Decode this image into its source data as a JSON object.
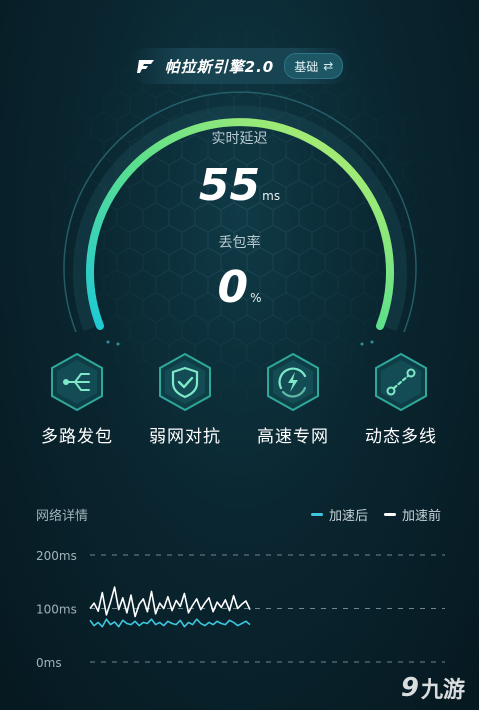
{
  "engine": {
    "title": "帕拉斯引擎2.0",
    "mode_label": "基础",
    "swap_icon": "⇄"
  },
  "latency": {
    "label": "实时延迟",
    "value": "55",
    "unit": "ms"
  },
  "packet_loss": {
    "label": "丢包率",
    "value": "0",
    "unit": "%"
  },
  "features": [
    {
      "label": "多路发包",
      "icon": "multipath-icon"
    },
    {
      "label": "弱网对抗",
      "icon": "shield-check-icon"
    },
    {
      "label": "高速专网",
      "icon": "lightning-icon"
    },
    {
      "label": "动态多线",
      "icon": "route-icon"
    }
  ],
  "details": {
    "title": "网络详情"
  },
  "legend": [
    {
      "label": "加速后",
      "color": "#3ec7e0"
    },
    {
      "label": "加速前",
      "color": "#ffffff"
    }
  ],
  "chart_data": {
    "type": "line",
    "ylabels": [
      "200ms",
      "100ms",
      "0ms"
    ],
    "ylim": [
      0,
      200
    ],
    "x": [
      0,
      1,
      2,
      3,
      4,
      5,
      6,
      7,
      8,
      9,
      10,
      11,
      12,
      13,
      14,
      15,
      16,
      17,
      18,
      19,
      20,
      21,
      22,
      23,
      24,
      25,
      26,
      27,
      28,
      29,
      30,
      31,
      32,
      33,
      34,
      35,
      36,
      37,
      38,
      39
    ],
    "series": [
      {
        "name": "加速后",
        "color": "#3ec7e0",
        "values": [
          78,
          68,
          74,
          66,
          80,
          70,
          75,
          66,
          78,
          72,
          70,
          76,
          68,
          74,
          72,
          80,
          70,
          74,
          68,
          76,
          72,
          70,
          78,
          66,
          74,
          70,
          80,
          72,
          68,
          74,
          70,
          76,
          72,
          70,
          78,
          74,
          68,
          72,
          76,
          70
        ]
      },
      {
        "name": "加速前",
        "color": "#ffffff",
        "values": [
          100,
          110,
          95,
          130,
          88,
          112,
          140,
          98,
          120,
          92,
          125,
          85,
          108,
          118,
          94,
          132,
          90,
          110,
          100,
          122,
          96,
          115,
          104,
          128,
          92,
          106,
          118,
          98,
          110,
          120,
          94,
          112,
          102,
          116,
          96,
          124,
          100,
          108,
          114,
          98
        ]
      }
    ]
  },
  "watermark": {
    "mark": "9",
    "text": "九游"
  }
}
